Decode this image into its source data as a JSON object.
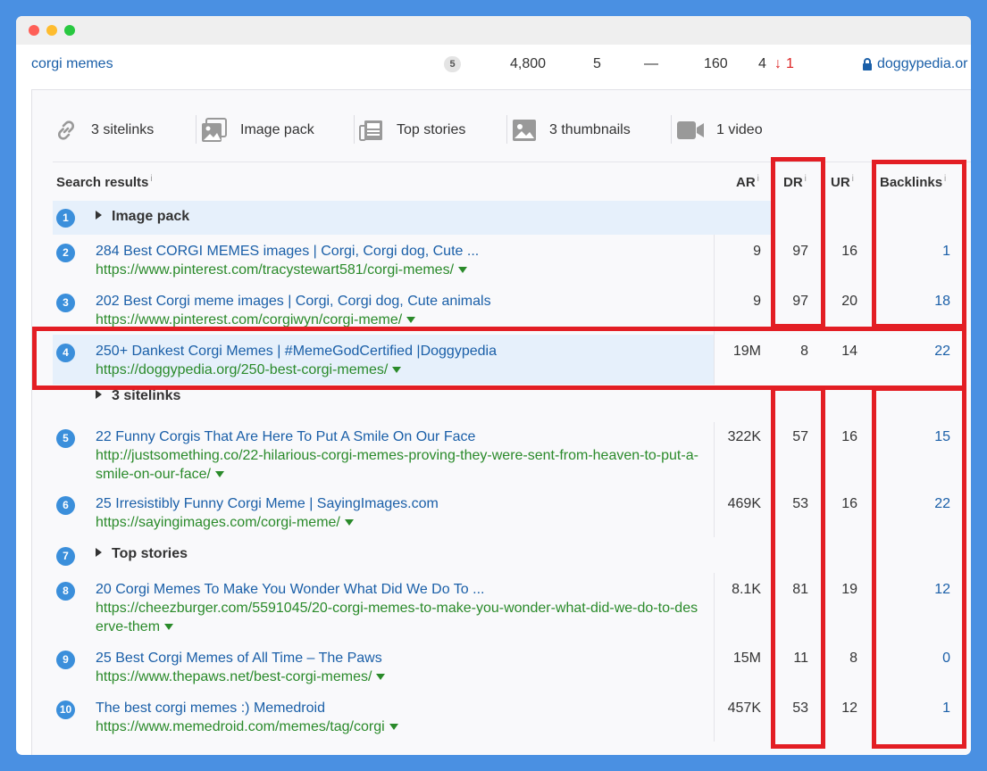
{
  "keyword_row": {
    "keyword": "corgi memes",
    "serp_features_count": "5",
    "volume": "4,800",
    "kd": "5",
    "cpc": "—",
    "traffic": "160",
    "position": "4",
    "position_change": "1",
    "url": "doggypedia.or"
  },
  "serp_features": [
    {
      "icon": "link-icon",
      "label": "3 sitelinks"
    },
    {
      "icon": "image-pack-icon",
      "label": "Image pack"
    },
    {
      "icon": "newspaper-icon",
      "label": "Top stories"
    },
    {
      "icon": "thumbnail-icon",
      "label": "3 thumbnails"
    },
    {
      "icon": "video-icon",
      "label": "1 video"
    }
  ],
  "table": {
    "headers": {
      "search_results": "Search results",
      "ar": "AR",
      "dr": "DR",
      "ur": "UR",
      "backlinks": "Backlinks",
      "info": "i"
    },
    "rows": [
      {
        "n": "1",
        "group": "Image pack"
      },
      {
        "n": "2",
        "title": "284 Best CORGI MEMES images | Corgi, Corgi dog, Cute ...",
        "url": "https://www.pinterest.com/tracystewart581/corgi-memes/",
        "ar": "9",
        "dr": "97",
        "ur": "16",
        "backlinks": "1"
      },
      {
        "n": "3",
        "title": "202 Best Corgi meme images | Corgi, Corgi dog, Cute animals",
        "url": "https://www.pinterest.com/corgiwyn/corgi-meme/",
        "ar": "9",
        "dr": "97",
        "ur": "20",
        "backlinks": "18"
      },
      {
        "n": "4",
        "title": "250+ Dankest Corgi Memes | #MemeGodCertified |Doggypedia",
        "url": "https://doggypedia.org/250-best-corgi-memes/",
        "ar": "19M",
        "dr": "8",
        "ur": "14",
        "backlinks": "22",
        "sublabel": "3 sitelinks"
      },
      {
        "n": "5",
        "title": "22 Funny Corgis That Are Here To Put A Smile On Our Face",
        "url": "http://justsomething.co/22-hilarious-corgi-memes-proving-they-were-sent-from-heaven-to-put-a-smile-on-our-face/",
        "ar": "322K",
        "dr": "57",
        "ur": "16",
        "backlinks": "15"
      },
      {
        "n": "6",
        "title": "25 Irresistibly Funny Corgi Meme | SayingImages.com",
        "url": "https://sayingimages.com/corgi-meme/",
        "ar": "469K",
        "dr": "53",
        "ur": "16",
        "backlinks": "22"
      },
      {
        "n": "7",
        "group": "Top stories"
      },
      {
        "n": "8",
        "title": "20 Corgi Memes To Make You Wonder What Did We Do To ...",
        "url": "https://cheezburger.com/5591045/20-corgi-memes-to-make-you-wonder-what-did-we-do-to-deserve-them",
        "ar": "8.1K",
        "dr": "81",
        "ur": "19",
        "backlinks": "12"
      },
      {
        "n": "9",
        "title": "25 Best Corgi Memes of All Time – The Paws",
        "url": "https://www.thepaws.net/best-corgi-memes/",
        "ar": "15M",
        "dr": "11",
        "ur": "8",
        "backlinks": "0"
      },
      {
        "n": "10",
        "title": "The best corgi memes :) Memedroid",
        "url": "https://www.memedroid.com/memes/tag/corgi",
        "ar": "457K",
        "dr": "53",
        "ur": "12",
        "backlinks": "1"
      }
    ]
  },
  "colors": {
    "highlight_red": "#e31e24",
    "link_blue": "#1a5fa8",
    "url_green": "#2a8a2a",
    "badge_blue": "#3b8fdb",
    "background": "#4a90e2"
  }
}
